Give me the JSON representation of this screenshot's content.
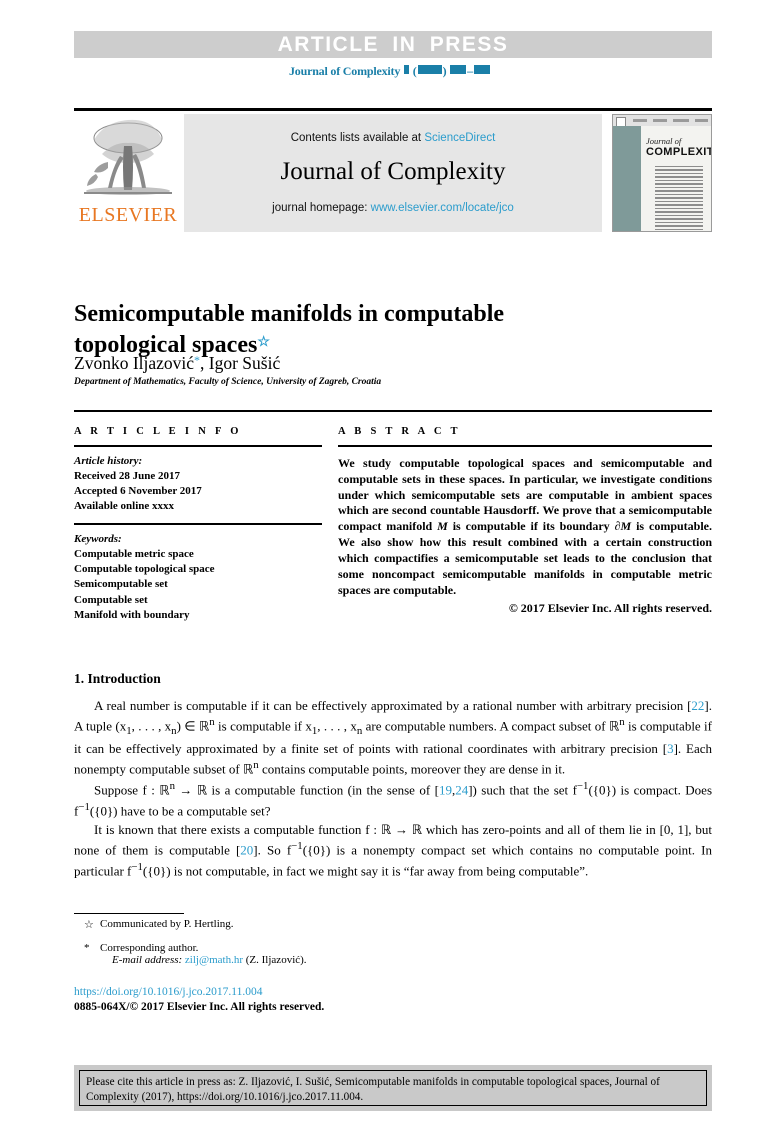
{
  "banner": {
    "article_in_press": "ARTICLE IN PRESS"
  },
  "journal_ref": {
    "name": "Journal of Complexity",
    "volume_placeholder": "▮",
    "year_placeholder": "▮▮▮▮",
    "pages_placeholder": "▮▮–▮▮"
  },
  "masthead": {
    "publisher": "ELSEVIER",
    "contents_prefix": "Contents lists available at ",
    "sciencedirect": "ScienceDirect",
    "journal_title": "Journal of Complexity",
    "homepage_prefix": "journal homepage: ",
    "homepage_url": "www.elsevier.com/locate/jco",
    "cover": {
      "line1": "Journal of",
      "line2": "COMPLEXITY"
    }
  },
  "article": {
    "title": "Semicomputable manifolds in computable topological spaces",
    "title_footnote_mark": "☆",
    "authors": "Zvonko Iljazović",
    "authors_corr_mark": "*",
    "authors_rest": ", Igor Sušić",
    "affiliation": "Department of Mathematics, Faculty of Science, University of Zagreb, Croatia"
  },
  "info": {
    "label": "A R T I C L E    I N F O",
    "history_label": "Article history:",
    "history": [
      "Received 28 June 2017",
      "Accepted 6 November 2017",
      "Available online xxxx"
    ],
    "keywords_label": "Keywords:",
    "keywords": [
      "Computable metric space",
      "Computable topological space",
      "Semicomputable set",
      "Computable set",
      "Manifold with boundary"
    ]
  },
  "abstract": {
    "label": "A B S T R A C T",
    "text_part1": "We study computable topological spaces and semicomputable and computable sets in these spaces. In particular, we investigate conditions under which semicomputable sets are computable in ambient spaces which are second countable Hausdorff. We prove that a semicomputable compact manifold ",
    "math_M": "M",
    "text_part2": " is computable if its boundary ",
    "math_dM": "∂M",
    "text_part3": " is computable. We also show how this result combined with a certain construction which compactifies a semicomputable set leads to the conclusion that some noncompact semicomputable manifolds in computable metric spaces are computable.",
    "copyright": "© 2017 Elsevier Inc. All rights reserved."
  },
  "introduction": {
    "heading": "1. Introduction",
    "p1_a": "A real number is computable if it can be effectively approximated by a rational number with arbitrary precision [",
    "p1_ref1": "22",
    "p1_b": "]. A tuple (x",
    "p1_c": ", . . . , x",
    "p1_d": ") ∈ ℝ",
    "p1_e": " is computable if x",
    "p1_f": ", . . . , x",
    "p1_g": " are computable numbers. A compact subset of ℝ",
    "p1_h": " is computable if it can be effectively approximated by a finite set of points with rational coordinates with arbitrary precision [",
    "p1_ref2": "3",
    "p1_i": "]. Each nonempty computable subset of ℝ",
    "p1_j": " contains computable points, moreover they are dense in it.",
    "p2_a": "Suppose f : ℝ",
    "p2_b": " → ℝ is a computable function (in the sense of [",
    "p2_ref1": "19",
    "p2_comma": ",",
    "p2_ref2": "24",
    "p2_c": "]) such that the set f",
    "p2_d": "({0}) is compact. Does f",
    "p2_e": "({0}) have to be a computable set?",
    "p3_a": "It is known that there exists a computable function f : ℝ → ℝ which has zero-points and all of them lie in [0, 1], but none of them is computable [",
    "p3_ref1": "20",
    "p3_b": "]. So f",
    "p3_c": "({0}) is a nonempty compact set which contains no computable point. In particular f",
    "p3_d": "({0}) is not computable, in fact we might say it is “far away from being computable”."
  },
  "footnotes": {
    "communicated_mark": "☆",
    "communicated": "Communicated by P. Hertling.",
    "corresponding_mark": "*",
    "corresponding": "Corresponding author.",
    "email_label": "E-mail address:",
    "email": "zilj@math.hr",
    "email_owner": "(Z. Iljazović).",
    "doi": "https://doi.org/10.1016/j.jco.2017.11.004",
    "issn": "0885-064X/© 2017 Elsevier Inc. All rights reserved."
  },
  "cite_box": {
    "text": "Please cite this article in press as: Z. Iljazović, I. Sušić, Semicomputable manifolds in computable topological spaces, Journal of Complexity (2017), https://doi.org/10.1016/j.jco.2017.11.004."
  },
  "colors": {
    "link_blue": "#2b9ccc",
    "journal_ref_blue": "#1a7fa8",
    "elsevier_orange": "#e87722",
    "banner_gray": "#cdcdcd",
    "masthead_gray": "#e6e6e6",
    "cite_gray": "#c9c9c9"
  }
}
